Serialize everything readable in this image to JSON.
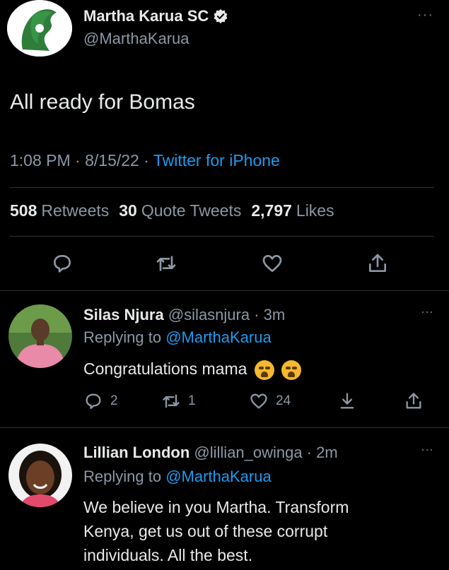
{
  "tweet": {
    "author_name": "Martha Karua SC",
    "author_handle": "@MarthaKarua",
    "text": "All ready for Bomas",
    "time": "1:08 PM · 8/15/22 · ",
    "source": "Twitter for iPhone",
    "stats": {
      "retweets_count": "508",
      "retweets_label": "Retweets",
      "quotes_count": "30",
      "quotes_label": "Quote Tweets",
      "likes_count": "2,797",
      "likes_label": "Likes"
    },
    "more": "···"
  },
  "replies": [
    {
      "name": "Silas Njura",
      "handle_time": " @silasnjura · 3m",
      "replying_prefix": "Replying to ",
      "replying_to": "@MarthaKarua",
      "text": "Congratulations mama",
      "reply_count": "2",
      "retweet_count": "1",
      "like_count": "24",
      "more": "···"
    },
    {
      "name": "Lillian London",
      "handle_time": " @lillian_owinga · 2m",
      "replying_prefix": "Replying to ",
      "replying_to": "@MarthaKarua",
      "text_line1": "We believe in you Martha. Transform",
      "text_line2": "Kenya, get us out of these corrupt",
      "text_line3": "individuals. All the best.",
      "more": "···"
    }
  ],
  "colors": {
    "accent": "#1d9bf0",
    "secondary": "#8b98a5",
    "background": "#000000"
  },
  "icons": [
    "verified-badge-icon",
    "reply-icon",
    "retweet-icon",
    "like-icon",
    "share-icon",
    "download-icon",
    "more-icon"
  ]
}
